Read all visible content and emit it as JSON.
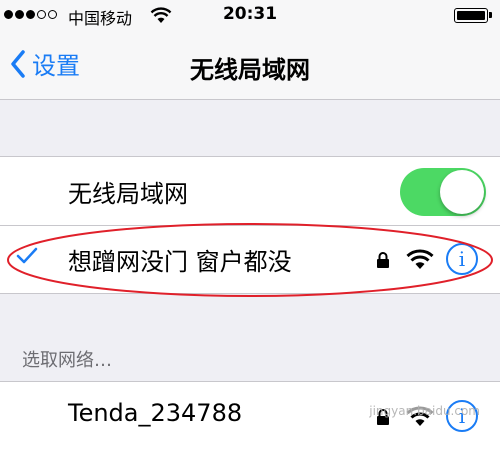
{
  "status_bar": {
    "carrier": "中国移动",
    "time": "20:31"
  },
  "nav": {
    "back_label": "设置",
    "title": "无线局域网"
  },
  "wifi_toggle": {
    "label": "无线局域网",
    "state": "on",
    "color": "#4cd964"
  },
  "current_network": {
    "name": "想蹭网没门 窗户都没",
    "connected": true,
    "secured": true
  },
  "choose_network": {
    "header": "选取网络…"
  },
  "networks": [
    {
      "name": "Tenda_234788",
      "secured": true
    }
  ],
  "icons": {
    "info": "i"
  },
  "watermark": "jingyan.baidu.com",
  "colors": {
    "accent": "#1a7cf5",
    "annotation": "#e0202a",
    "background": "#efeff4"
  }
}
